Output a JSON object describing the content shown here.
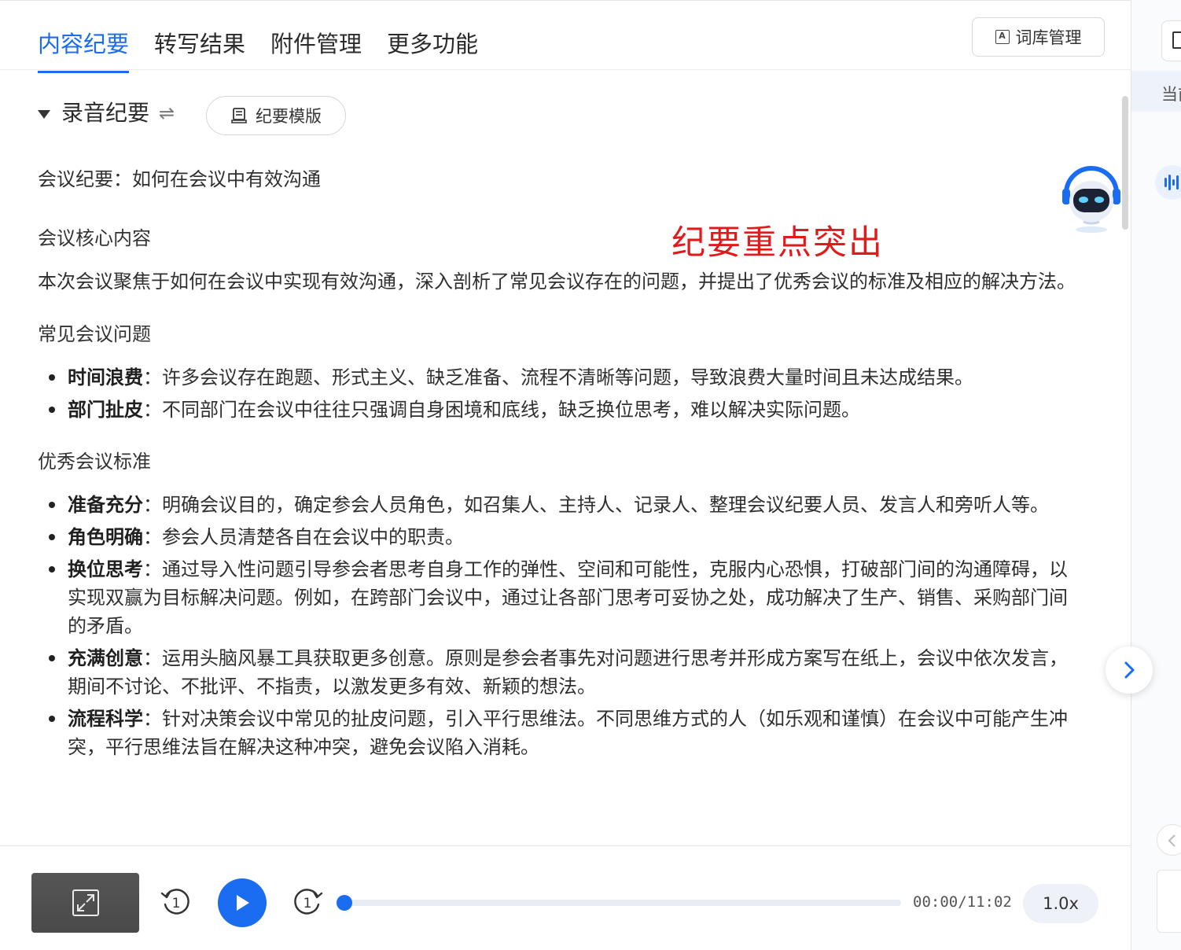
{
  "tabs": {
    "content_summary": "内容纪要",
    "transcription": "转写结果",
    "attachments": "附件管理",
    "more": "更多功能"
  },
  "toolbar": {
    "lexicon_label": "词库管理",
    "lexicon_icon_glyph": "A"
  },
  "summary": {
    "title": "录音纪要",
    "switch_icon": "⇌",
    "template_button": "纪要模版"
  },
  "annotation": {
    "highlight_note": "纪要重点突出"
  },
  "document": {
    "meeting_title": "会议纪要：如何在会议中有效沟通",
    "core_heading": "会议核心内容",
    "core_paragraph": "本次会议聚焦于如何在会议中实现有效沟通，深入剖析了常见会议存在的问题，并提出了优秀会议的标准及相应的解决方法。",
    "problems_heading": "常见会议问题",
    "problems": [
      {
        "term": "时间浪费",
        "text": "：许多会议存在跑题、形式主义、缺乏准备、流程不清晰等问题，导致浪费大量时间且未达成结果。"
      },
      {
        "term": "部门扯皮",
        "text": "：不同部门在会议中往往只强调自身困境和底线，缺乏换位思考，难以解决实际问题。"
      }
    ],
    "standards_heading": "优秀会议标准",
    "standards": [
      {
        "term": "准备充分",
        "text": "：明确会议目的，确定参会人员角色，如召集人、主持人、记录人、整理会议纪要人员、发言人和旁听人等。"
      },
      {
        "term": "角色明确",
        "text": "：参会人员清楚各自在会议中的职责。"
      },
      {
        "term": "换位思考",
        "text": "：通过导入性问题引导参会者思考自身工作的弹性、空间和可能性，克服内心恐惧，打破部门间的沟通障碍，以实现双赢为目标解决问题。例如，在跨部门会议中，通过让各部门思考可妥协之处，成功解决了生产、销售、采购部门间的矛盾。"
      },
      {
        "term": "充满创意",
        "text": "：运用头脑风暴工具获取更多创意。原则是参会者事先对问题进行思考并形成方案写在纸上，会议中依次发言，期间不讨论、不批评、不指责，以激发更多有效、新颖的想法。"
      },
      {
        "term": "流程科学",
        "text": "：针对决策会议中常见的扯皮问题，引入平行思维法。不同思维方式的人（如乐观和谨慎）在会议中可能产生冲突，平行思维法旨在解决这种冲突，避免会议陷入消耗。"
      }
    ]
  },
  "player": {
    "time_display": "00:00/11:02",
    "speed": "1.0x",
    "progress_fraction": 0.0,
    "rewind_label": "1",
    "forward_label": "1"
  },
  "side_panel": {
    "strip_text": "当前"
  },
  "colors": {
    "accent": "#1a6cf0",
    "highlight_note": "#e01b1b"
  }
}
